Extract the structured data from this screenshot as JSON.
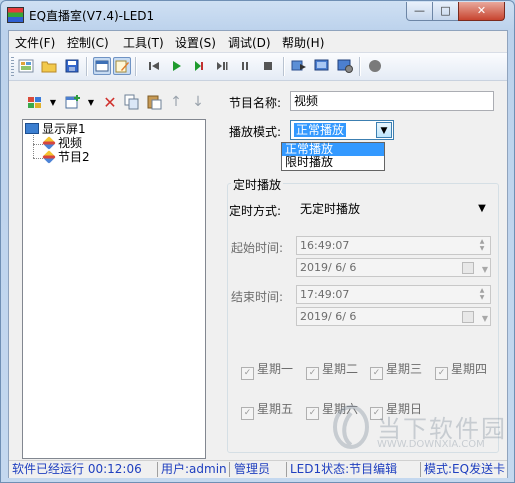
{
  "window": {
    "title": "EQ直播室(V7.4)-LED1"
  },
  "caption": {
    "minimize": "—",
    "maximize": "□",
    "close": "✕"
  },
  "menu": [
    "文件(F)",
    "控制(C)",
    "工具(T)",
    "设置(S)",
    "调试(D)",
    "帮助(H)"
  ],
  "toolbar": {
    "buttons": [
      "new-icon",
      "open-icon",
      "save-icon",
      "window-mode-icon",
      "edit-mode-icon",
      "first-icon",
      "play-icon",
      "step-icon",
      "play-pause-icon",
      "pause-icon",
      "stop-icon",
      "send-icon",
      "screen-icon",
      "screen-settings-icon",
      "record-icon"
    ]
  },
  "left_toolbar": {
    "buttons": [
      "grid-icon",
      "add-icon",
      "delete-icon",
      "copy-icon",
      "paste-icon",
      "move-up-icon",
      "move-down-icon"
    ]
  },
  "tree": {
    "root": "显示屏1",
    "children": [
      "视频",
      "节目2"
    ]
  },
  "form": {
    "program_name_label": "节目名称:",
    "program_name_value": "视频",
    "play_mode_label": "播放模式:",
    "play_mode_value": "正常播放",
    "play_mode_options": [
      "正常播放",
      "限时播放"
    ],
    "timed_group_caption": "定时播放",
    "timing_mode_label": "定时方式:",
    "timing_mode_value": "无定时播放",
    "start_time_label": "起始时间:",
    "start_time_value": "16:49:07",
    "start_date_value": "2019/  6/  6",
    "end_time_label": "结束时间:",
    "end_time_value": "17:49:07",
    "end_date_value": "2019/  6/  6",
    "weekdays": [
      "星期一",
      "星期二",
      "星期三",
      "星期四",
      "星期五",
      "星期六",
      "星期日"
    ]
  },
  "status": {
    "runtime": "软件已经运行 00:12:06",
    "user": "用户:admin",
    "role": "管理员",
    "led_state": "LED1状态:节目编辑",
    "mode": "模式:EQ发送卡"
  },
  "watermark": {
    "text": "当下软件园",
    "sub": "WWW.DOWNXIA.COM"
  }
}
